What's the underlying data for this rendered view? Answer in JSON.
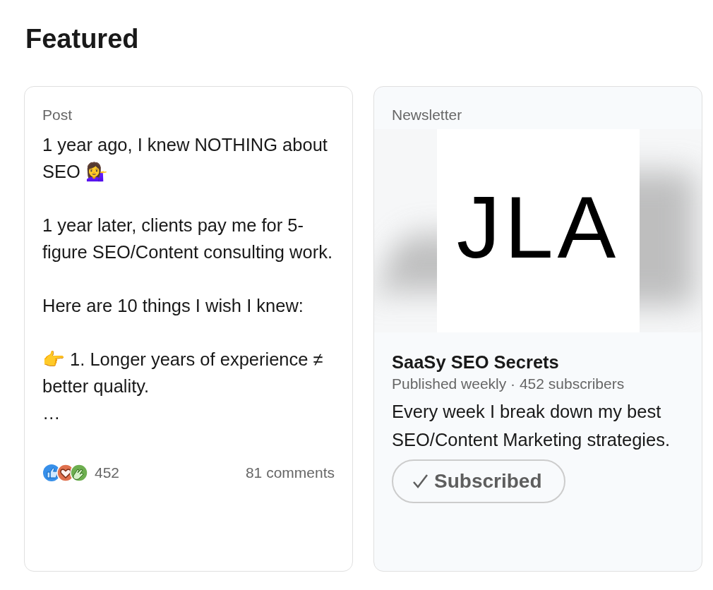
{
  "section": {
    "title": "Featured"
  },
  "items": [
    {
      "kind": "post",
      "type_label": "Post",
      "body": "1 year ago, I knew NOTHING about SEO 💁‍♀️\n\n1 year later, clients pay me for 5-figure SEO/Content consulting work.\n\nHere are 10 things I wish I knew:\n\n👉 1. Longer years of experience ≠ better quality.\n…",
      "reactions_count": "452",
      "comments": "81 comments"
    },
    {
      "kind": "newsletter",
      "type_label": "Newsletter",
      "cover_text": "JLA",
      "title": "SaaSy SEO Secrets",
      "meta": "Published weekly · 452 subscribers",
      "description": "Every week I break down my best SEO/Content Marketing strategies.",
      "button": {
        "label": "Subscribed",
        "subscribed": true
      }
    }
  ]
}
